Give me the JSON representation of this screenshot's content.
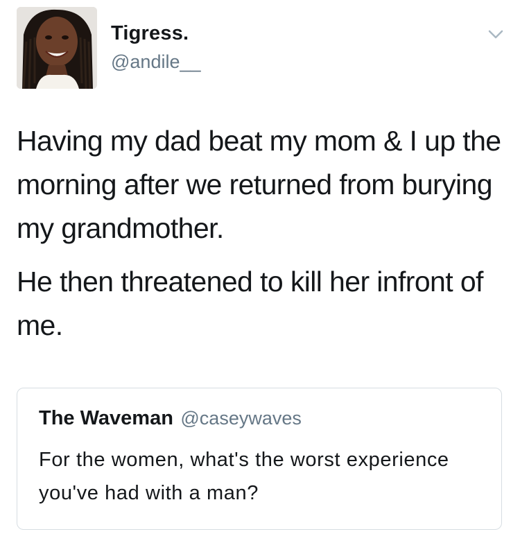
{
  "tweet": {
    "display_name": "Tigress.",
    "handle": "@andile__",
    "avatar_icon": "profile-photo",
    "menu_icon": "chevron-down-icon",
    "paragraphs": [
      "Having my dad beat my mom & I up the morning after we returned from burying my grandmother.",
      "He then threatened to kill her infront of me."
    ]
  },
  "quoted_tweet": {
    "display_name": "The Waveman",
    "handle": "@caseywaves",
    "text": "For the women, what's the worst experience you've had with a man?"
  },
  "colors": {
    "primary_text": "#14171a",
    "secondary_text": "#657786",
    "border": "#d6dde2"
  }
}
